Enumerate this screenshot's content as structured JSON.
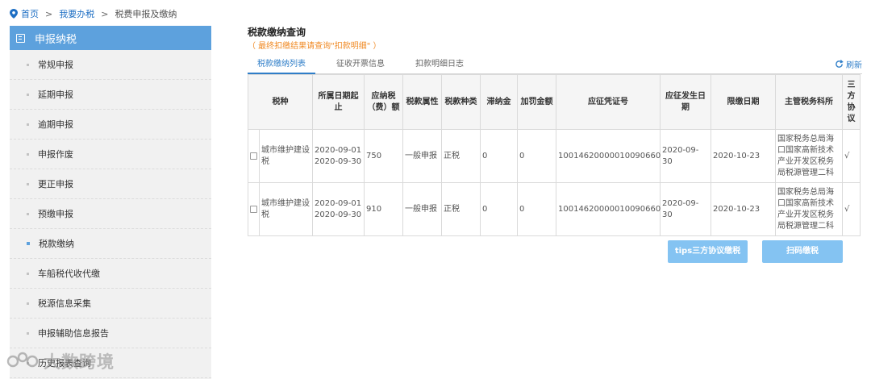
{
  "breadcrumb": {
    "home": "首页",
    "separator": ">",
    "level2": "我要办税",
    "current": "税费申报及缴纳"
  },
  "sidebar": {
    "title": "申报纳税",
    "items": [
      {
        "label": "常规申报"
      },
      {
        "label": "延期申报"
      },
      {
        "label": "逾期申报"
      },
      {
        "label": "申报作废"
      },
      {
        "label": "更正申报"
      },
      {
        "label": "预缴申报"
      },
      {
        "label": "税款缴纳"
      },
      {
        "label": "车船税代收代缴"
      },
      {
        "label": "税源信息采集"
      },
      {
        "label": "申报辅助信息报告"
      },
      {
        "label": "历史报表查询"
      }
    ]
  },
  "main": {
    "title": "税款缴纳查询",
    "note": "（ 最终扣缴结果请查询\"扣款明细\" ）",
    "tabs": [
      "税款缴纳列表",
      "征收开票信息",
      "扣款明细日志"
    ],
    "refresh": "刷新",
    "table": {
      "headers": [
        "税种",
        "所属日期起止",
        "应纳税（费）额",
        "税款属性",
        "税款种类",
        "滞纳金",
        "加罚金额",
        "应征凭证号",
        "应征发生日期",
        "限缴日期",
        "主管税务科所",
        "三方协议"
      ],
      "rows": [
        {
          "tax_type": "城市维护建设税",
          "period_start": "2020-09-01",
          "period_end": "2020-09-30",
          "amount": "750",
          "attribute": "一般申报",
          "kind": "正税",
          "late_fee": "0",
          "penalty": "0",
          "voucher_no": "10014620000010090660",
          "occur_date": "2020-09-30",
          "deadline": "2020-10-23",
          "office": "国家税务总局海口国家高新技术产业开发区税务局税源管理二科",
          "agreement": "√"
        },
        {
          "tax_type": "城市维护建设税",
          "period_start": "2020-09-01",
          "period_end": "2020-09-30",
          "amount": "910",
          "attribute": "一般申报",
          "kind": "正税",
          "late_fee": "0",
          "penalty": "0",
          "voucher_no": "10014620000010090660",
          "occur_date": "2020-09-30",
          "deadline": "2020-10-23",
          "office": "国家税务总局海口国家高新技术产业开发区税务局税源管理二科",
          "agreement": "√"
        }
      ]
    },
    "buttons": {
      "tips_pay": "tips三方协议缴税",
      "scan_pay": "扫码缴税"
    }
  },
  "watermark": "大数跨境",
  "colors": {
    "accent": "#5da1dd",
    "button": "#84c3f2",
    "link": "#1e6fc4",
    "note": "#f08a24"
  },
  "icons": [
    "location-pin-icon",
    "list-icon",
    "refresh-icon"
  ]
}
